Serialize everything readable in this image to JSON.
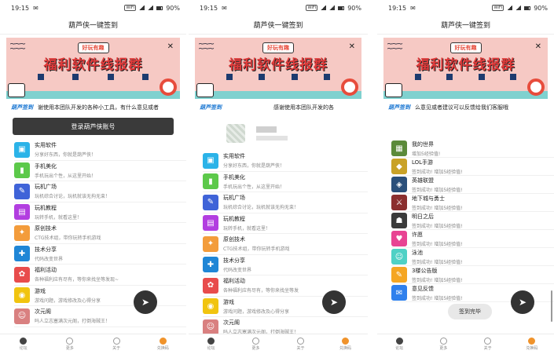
{
  "status": {
    "time": "19:15",
    "network": "WIFI",
    "battery": "90%"
  },
  "app_title": "葫芦侠一键签到",
  "banner": {
    "tag": "好玩有趣",
    "title": "福利软件线报群"
  },
  "notices": [
    "谢使用本团队开发的各种小工具，有什么意见或者",
    "感谢使用本团队开发的各",
    "么意见或者建议可以反馈给我们客服哦"
  ],
  "notice_logo": "葫芦签到",
  "login_button": "登录葫芦侠账号",
  "categories": [
    {
      "title": "实用软件",
      "desc": "分享好东西，你就是葫芦侠！",
      "icon": "cube-icon",
      "color": "#2bb3e8"
    },
    {
      "title": "手机美化",
      "desc": "手机玩出个性，从这里开始！",
      "icon": "phone-icon",
      "color": "#5cc94a"
    },
    {
      "title": "玩机广场",
      "desc": "玩机综合讨论，玩机就该无拘无束！",
      "icon": "pen-icon",
      "color": "#3f63d8"
    },
    {
      "title": "玩机教程",
      "desc": "玩转手机，就看这里！",
      "icon": "book-icon",
      "color": "#b23ee0"
    },
    {
      "title": "原创技术",
      "desc": "CTG技术组，带你玩转手机游戏",
      "icon": "bulb-icon",
      "color": "#f39c3b"
    },
    {
      "title": "技术分享",
      "desc": "代码改变世界",
      "icon": "wrench-icon",
      "color": "#1f86d6"
    },
    {
      "title": "福利活动",
      "desc": "各种福利应有尽有，等你来找坐等发现~",
      "icon": "gift-icon",
      "color": "#e84c4c"
    },
    {
      "title": "游戏",
      "desc": "游戏问题，游戏修改及心得分享",
      "icon": "gamepad-icon",
      "color": "#f1c40f"
    },
    {
      "title": "次元阁",
      "desc": "吗人立志塞满次元阁，打倒海贼王！",
      "icon": "anime-icon",
      "color": "#d98080"
    }
  ],
  "categories_b_extra_desc": "各种福利应有尽有，等你来找坐等发",
  "checkins": [
    {
      "title": "我的世界",
      "desc": "增加5经验值!",
      "color": "#5b8a3a"
    },
    {
      "title": "LOL手游",
      "desc": "签到成功! 增加5经验值!",
      "color": "#c9a227"
    },
    {
      "title": "英雄联盟",
      "desc": "签到成功! 增加5经验值!",
      "color": "#2a4f7a"
    },
    {
      "title": "地下城与勇士",
      "desc": "签到成功! 增加5经验值!",
      "color": "#8b2f2f"
    },
    {
      "title": "明日之后",
      "desc": "签到成功! 增加5经验值!",
      "color": "#3a3a3a"
    },
    {
      "title": "许愿",
      "desc": "签到成功! 增加5经验值!",
      "color": "#e84393"
    },
    {
      "title": "泳池",
      "desc": "签到成功! 增加5经验值!",
      "color": "#4fd1c5"
    },
    {
      "title": "3楼公告版",
      "desc": "签到成功! 增加5经验值!",
      "color": "#f5a623"
    },
    {
      "title": "意见反馈",
      "desc": "签到成功! 增加5经验值!",
      "color": "#2f80ed"
    }
  ],
  "toast": "签到完毕",
  "tabs": [
    "论坛",
    "更多",
    "关于",
    "兑换码"
  ],
  "tabs_right": [
    "论坛",
    "更多",
    "关于",
    "兑换码"
  ]
}
